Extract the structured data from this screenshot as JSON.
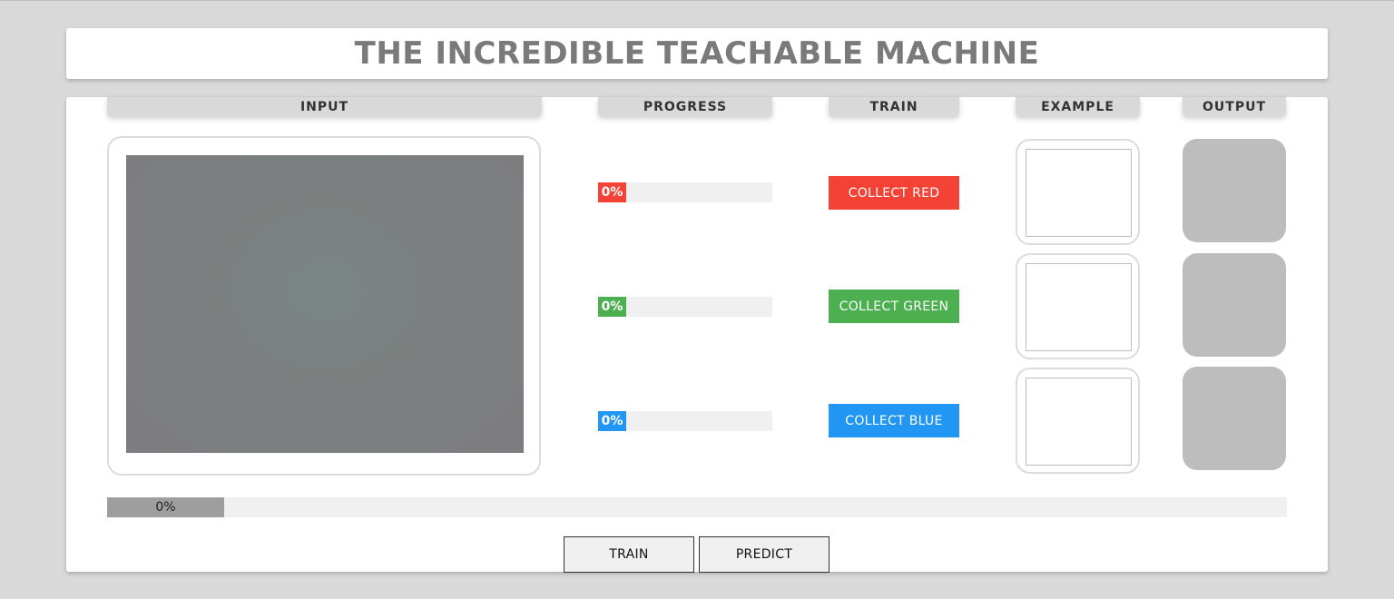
{
  "header": {
    "title": "THE INCREDIBLE TEACHABLE MACHINE"
  },
  "columns": {
    "input": "INPUT",
    "progress": "PROGRESS",
    "train": "TRAIN",
    "example": "EXAMPLE",
    "output": "OUTPUT"
  },
  "classes": [
    {
      "name": "red",
      "progress": 0,
      "progress_label": "0%",
      "button_label": "COLLECT RED",
      "color": "#f44336"
    },
    {
      "name": "green",
      "progress": 0,
      "progress_label": "0%",
      "button_label": "COLLECT GREEN",
      "color": "#4caf50"
    },
    {
      "name": "blue",
      "progress": 0,
      "progress_label": "0%",
      "button_label": "COLLECT BLUE",
      "color": "#2196f3"
    }
  ],
  "output_color": "#bdbdbd",
  "total_progress": {
    "value": 0,
    "label": "0%",
    "color": "#9e9e9e"
  },
  "actions": {
    "train_label": "TRAIN",
    "predict_label": "PREDICT"
  }
}
